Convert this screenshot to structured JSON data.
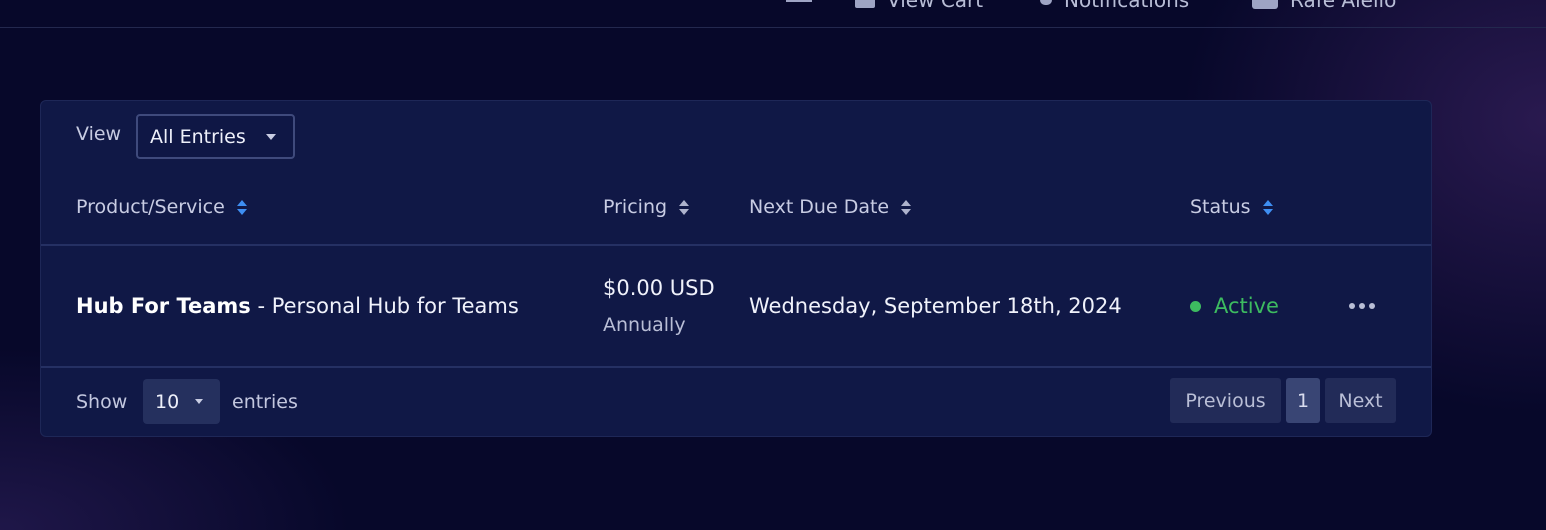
{
  "topnav": {
    "items": [
      {
        "icon": "share-icon",
        "label": ""
      },
      {
        "icon": "cart-icon",
        "label": "View Cart"
      },
      {
        "icon": "bell-icon",
        "label": "Notifications"
      },
      {
        "icon": "user-icon",
        "label": "Rafe Alello"
      }
    ]
  },
  "view": {
    "label": "View",
    "selected": "All Entries"
  },
  "table": {
    "columns": [
      "Product/Service",
      "Pricing",
      "Next Due Date",
      "Status"
    ],
    "rows": [
      {
        "product_name": "Hub For Teams",
        "product_desc": " - Personal Hub for Teams",
        "price": "$0.00 USD",
        "cycle": "Annually",
        "due_date": "Wednesday, September 18th, 2024",
        "status": "Active"
      }
    ]
  },
  "footer": {
    "show_label": "Show",
    "page_length": "10",
    "entries_label": "entries",
    "previous": "Previous",
    "current_page": "1",
    "next": "Next"
  },
  "colors": {
    "background": "#07082a",
    "panel": "#101846",
    "accent_sort": "#3e8ef2",
    "status_active": "#3dbb60"
  }
}
